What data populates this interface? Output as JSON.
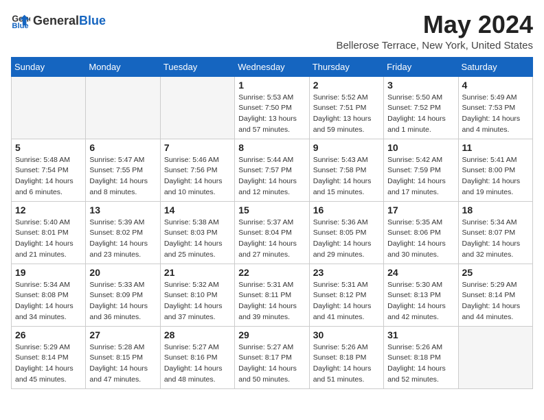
{
  "header": {
    "logo_general": "General",
    "logo_blue": "Blue",
    "month": "May 2024",
    "location": "Bellerose Terrace, New York, United States"
  },
  "weekdays": [
    "Sunday",
    "Monday",
    "Tuesday",
    "Wednesday",
    "Thursday",
    "Friday",
    "Saturday"
  ],
  "weeks": [
    [
      {
        "day": "",
        "info": ""
      },
      {
        "day": "",
        "info": ""
      },
      {
        "day": "",
        "info": ""
      },
      {
        "day": "1",
        "info": "Sunrise: 5:53 AM\nSunset: 7:50 PM\nDaylight: 13 hours and 57 minutes."
      },
      {
        "day": "2",
        "info": "Sunrise: 5:52 AM\nSunset: 7:51 PM\nDaylight: 13 hours and 59 minutes."
      },
      {
        "day": "3",
        "info": "Sunrise: 5:50 AM\nSunset: 7:52 PM\nDaylight: 14 hours and 1 minute."
      },
      {
        "day": "4",
        "info": "Sunrise: 5:49 AM\nSunset: 7:53 PM\nDaylight: 14 hours and 4 minutes."
      }
    ],
    [
      {
        "day": "5",
        "info": "Sunrise: 5:48 AM\nSunset: 7:54 PM\nDaylight: 14 hours and 6 minutes."
      },
      {
        "day": "6",
        "info": "Sunrise: 5:47 AM\nSunset: 7:55 PM\nDaylight: 14 hours and 8 minutes."
      },
      {
        "day": "7",
        "info": "Sunrise: 5:46 AM\nSunset: 7:56 PM\nDaylight: 14 hours and 10 minutes."
      },
      {
        "day": "8",
        "info": "Sunrise: 5:44 AM\nSunset: 7:57 PM\nDaylight: 14 hours and 12 minutes."
      },
      {
        "day": "9",
        "info": "Sunrise: 5:43 AM\nSunset: 7:58 PM\nDaylight: 14 hours and 15 minutes."
      },
      {
        "day": "10",
        "info": "Sunrise: 5:42 AM\nSunset: 7:59 PM\nDaylight: 14 hours and 17 minutes."
      },
      {
        "day": "11",
        "info": "Sunrise: 5:41 AM\nSunset: 8:00 PM\nDaylight: 14 hours and 19 minutes."
      }
    ],
    [
      {
        "day": "12",
        "info": "Sunrise: 5:40 AM\nSunset: 8:01 PM\nDaylight: 14 hours and 21 minutes."
      },
      {
        "day": "13",
        "info": "Sunrise: 5:39 AM\nSunset: 8:02 PM\nDaylight: 14 hours and 23 minutes."
      },
      {
        "day": "14",
        "info": "Sunrise: 5:38 AM\nSunset: 8:03 PM\nDaylight: 14 hours and 25 minutes."
      },
      {
        "day": "15",
        "info": "Sunrise: 5:37 AM\nSunset: 8:04 PM\nDaylight: 14 hours and 27 minutes."
      },
      {
        "day": "16",
        "info": "Sunrise: 5:36 AM\nSunset: 8:05 PM\nDaylight: 14 hours and 29 minutes."
      },
      {
        "day": "17",
        "info": "Sunrise: 5:35 AM\nSunset: 8:06 PM\nDaylight: 14 hours and 30 minutes."
      },
      {
        "day": "18",
        "info": "Sunrise: 5:34 AM\nSunset: 8:07 PM\nDaylight: 14 hours and 32 minutes."
      }
    ],
    [
      {
        "day": "19",
        "info": "Sunrise: 5:34 AM\nSunset: 8:08 PM\nDaylight: 14 hours and 34 minutes."
      },
      {
        "day": "20",
        "info": "Sunrise: 5:33 AM\nSunset: 8:09 PM\nDaylight: 14 hours and 36 minutes."
      },
      {
        "day": "21",
        "info": "Sunrise: 5:32 AM\nSunset: 8:10 PM\nDaylight: 14 hours and 37 minutes."
      },
      {
        "day": "22",
        "info": "Sunrise: 5:31 AM\nSunset: 8:11 PM\nDaylight: 14 hours and 39 minutes."
      },
      {
        "day": "23",
        "info": "Sunrise: 5:31 AM\nSunset: 8:12 PM\nDaylight: 14 hours and 41 minutes."
      },
      {
        "day": "24",
        "info": "Sunrise: 5:30 AM\nSunset: 8:13 PM\nDaylight: 14 hours and 42 minutes."
      },
      {
        "day": "25",
        "info": "Sunrise: 5:29 AM\nSunset: 8:14 PM\nDaylight: 14 hours and 44 minutes."
      }
    ],
    [
      {
        "day": "26",
        "info": "Sunrise: 5:29 AM\nSunset: 8:14 PM\nDaylight: 14 hours and 45 minutes."
      },
      {
        "day": "27",
        "info": "Sunrise: 5:28 AM\nSunset: 8:15 PM\nDaylight: 14 hours and 47 minutes."
      },
      {
        "day": "28",
        "info": "Sunrise: 5:27 AM\nSunset: 8:16 PM\nDaylight: 14 hours and 48 minutes."
      },
      {
        "day": "29",
        "info": "Sunrise: 5:27 AM\nSunset: 8:17 PM\nDaylight: 14 hours and 50 minutes."
      },
      {
        "day": "30",
        "info": "Sunrise: 5:26 AM\nSunset: 8:18 PM\nDaylight: 14 hours and 51 minutes."
      },
      {
        "day": "31",
        "info": "Sunrise: 5:26 AM\nSunset: 8:18 PM\nDaylight: 14 hours and 52 minutes."
      },
      {
        "day": "",
        "info": ""
      }
    ]
  ]
}
